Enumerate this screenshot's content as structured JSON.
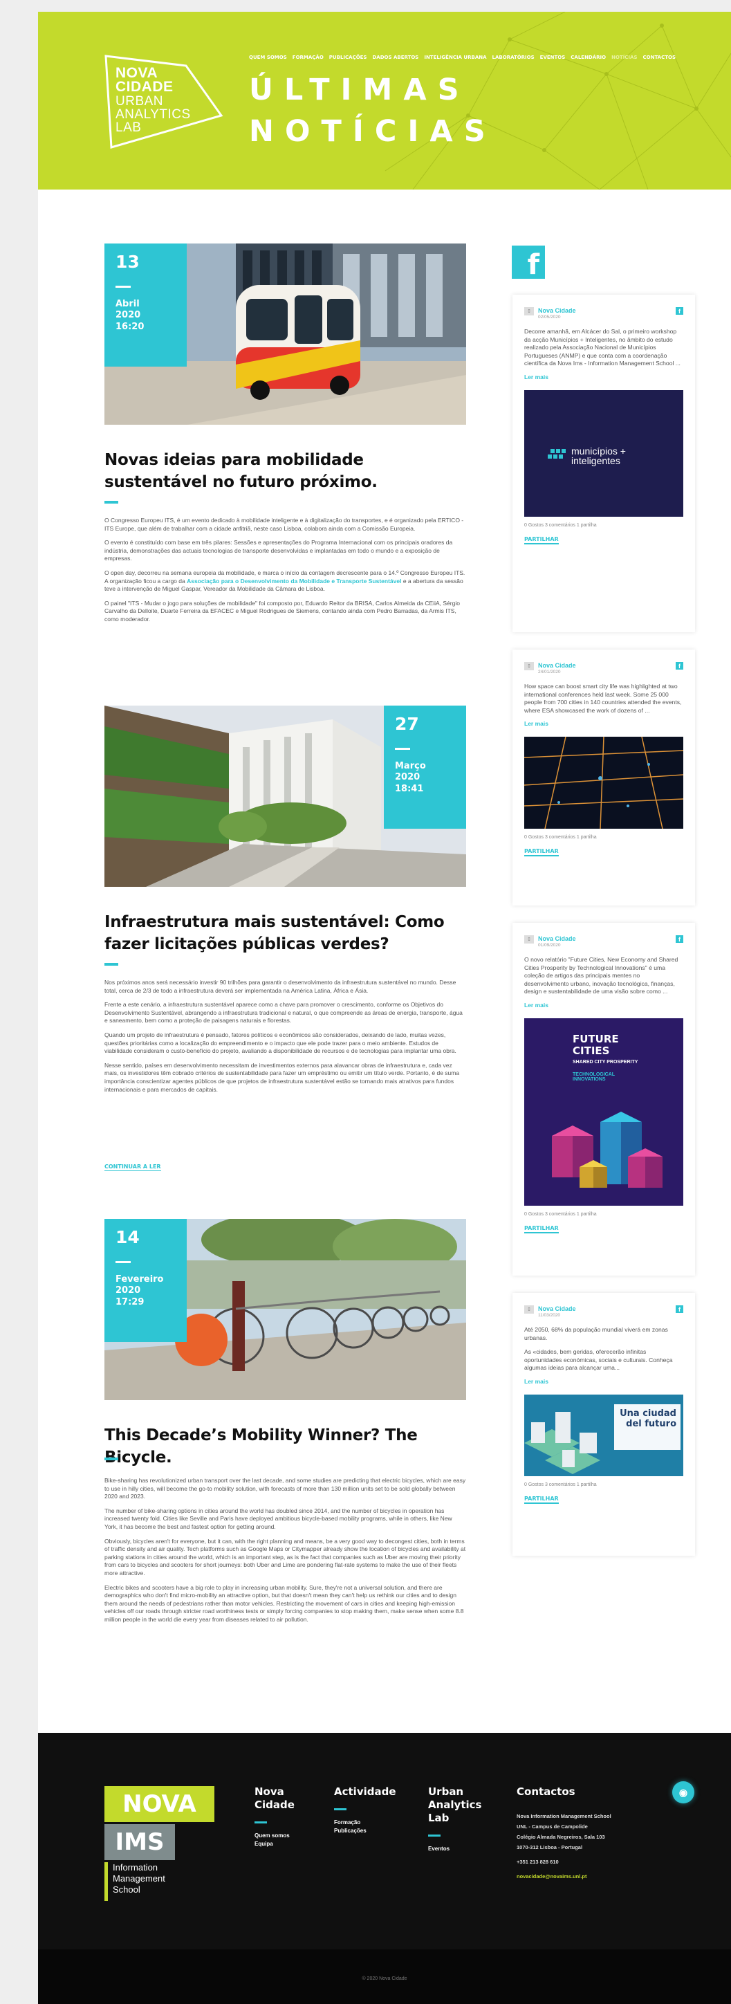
{
  "header": {
    "logo_lines": [
      "NOVA",
      "CIDADE",
      "URBAN",
      "ANALYTICS",
      "LAB"
    ],
    "nav": [
      "QUEM SOMOS",
      "FORMAÇÃO",
      "PUBLICAÇÕES",
      "DADOS ABERTOS",
      "INTELIGÊNCIA URBANA",
      "LABORATÓRIOS",
      "EVENTOS",
      "CALENDÁRIO",
      "NOTÍCIAS",
      "CONTACTOS"
    ],
    "title_line1": "ÚLTIMAS",
    "title_line2": "NOTÍCIAS",
    "colors": {
      "lime": "#c3da2c",
      "cyan": "#2ec5d3"
    }
  },
  "articles": [
    {
      "day": "13",
      "month": "Abril",
      "year": "2020",
      "time": "16:20",
      "title": "Novas ideias para mobilidade sustentável no futuro próximo.",
      "paragraphs": [
        "O Congresso Europeu ITS, é um evento dedicado à mobilidade inteligente e à digitalização do transportes, e é organizado pela ERTICO - ITS Europe, que além de trabalhar com a cidade anfitriã, neste caso Lisboa, colabora ainda com a Comissão Europeia.",
        "O evento é constituído com base em três pilares: Sessões e apresentações do Programa Internacional com os principais oradores da indústria, demonstrações das actuais tecnologias de transporte desenvolvidas e implantadas em todo o mundo e a exposição de empresas.",
        "O painel \"ITS - Mudar o jogo para soluções de mobilidade\" foi composto por, Eduardo Reitor da BRISA, Carlos Almeida da CEiiA, Sérgio Carvalho da Delloite, Duarte Ferreira da EFACEC e Miguel Rodrigues de Siemens, contando ainda com Pedro Barradas, da Armis ITS, como moderador."
      ],
      "para_link_before": "O open day, decorreu na semana europeia da mobilidade, e marca o início da contagem decrescente para o 14.º Congresso Europeu ITS. A organização ficou a cargo da ",
      "para_link": "Associação para o Desenvolvimento da Mobilidade e Transporte Sustentável",
      "para_link_after": " e a abertura da sessão teve a intervenção de Miguel Gaspar, Vereador da Mobilidade da Câmara de Lisboa."
    },
    {
      "day": "27",
      "month": "Março",
      "year": "2020",
      "time": "18:41",
      "title": "Infraestrutura mais sustentável: Como fazer licitações públicas verdes?",
      "paragraphs": [
        "Nos próximos anos será necessário investir 90 trilhões para garantir o desenvolvimento da infraestrutura sustentável no mundo. Desse total, cerca de 2/3 de todo a infraestrutura deverá ser implementada na América Latina, África e Ásia.",
        "Frente a este cenário, a infraestrutura sustentável aparece como a chave para promover o crescimento, conforme os Objetivos do Desenvolvimento Sustentável, abrangendo a infraestrutura tradicional e natural, o que compreende as áreas de energia, transporte, água e saneamento, bem como a proteção de paisagens naturais e florestas.",
        "Quando um projeto de infraestrutura é pensado, fatores políticos e econômicos são considerados, deixando de lado, muitas vezes, questões prioritárias como a localização do empreendimento e o impacto que ele pode trazer para o meio ambiente. Estudos de viabilidade consideram o custo-benefício do projeto, avaliando a disponibilidade de recursos e de tecnologias para implantar uma obra.",
        "Nesse sentido, países em desenvolvimento necessitam de investimentos externos para alavancar obras de infraestrutura e, cada vez mais, os investidores têm cobrado critérios de sustentabilidade para fazer um empréstimo ou emitir um título verde. Portanto, é de suma importância conscientizar agentes públicos de que projetos de infraestrutura sustentável estão se tornando mais atrativos para fundos internacionais e para mercados de capitais."
      ],
      "read_more": "CONTINUAR A LER"
    },
    {
      "day": "14",
      "month": "Fevereiro",
      "year": "2020",
      "time": "17:29",
      "title": "This Decade’s Mobility Winner? The Bicycle.",
      "paragraphs": [
        "Bike-sharing has revolutionized urban transport over the last decade, and some studies are predicting that electric bicycles, which are easy to use in hilly cities, will become the go-to mobility solution, with forecasts of more than 130 million units set to be sold globally between 2020 and 2023.",
        "The number of bike-sharing options in cities around the world has doubled since 2014, and the number of bicycles in operation has increased twenty fold. Cities like Seville and Paris have deployed ambitious bicycle-based mobility programs, while in others, like New York, it has become the best and fastest option for getting around.",
        "Obviously, bicycles aren't for everyone, but it can, with the right planning and means, be a very good way to decongest cities, both in terms of traffic density and air quality. Tech platforms such as Google Maps or Citymapper already show the location of bicycles and availability at parking stations in cities around the world, which is an important step, as is the fact that companies such as Uber are moving their priority from cars to bicycles and scooters for short journeys: both Uber and Lime are pondering flat-rate systems to make the use of their fleets more attractive.",
        "Electric bikes and scooters have a big role to play in increasing urban mobility. Sure, they're not a universal solution, and there are demographics who don't find micro-mobility an attractive option, but that doesn't mean they can't help us rethink our cities and to design them around the needs of pedestrians rather than motor vehicles. Restricting the movement of cars in cities and keeping high-emission vehicles off our roads through stricter road worthiness tests or simply forcing companies to stop making them, make sense when some 8.8 million people in the world die every year from diseases related to air pollution."
      ]
    }
  ],
  "sidebar": {
    "fb_glyph": "f",
    "cards": [
      {
        "name": "Nova Cidade",
        "date": "02/05/2020",
        "text": "Decorre amanhã, em Alcácer do Sal, o primeiro workshop da acção Municípios + Inteligentes, no âmbito do estudo realizado pela Associação Nacional de Municípios Portugueses (ANMP) e que conta com a coordenação científica da Nova Ims - Information Management School ...",
        "read_more": "Ler mais",
        "image_caption": "municípios + inteligentes",
        "stats": "0 Gostos 3 comentários 1 partilha",
        "share": "PARTILHAR"
      },
      {
        "name": "Nova Cidade",
        "date": "24/01/2020",
        "text": "How space can boost smart city life was highlighted at two international conferences held last week. Some 25 000 people from 700 cities in 140 countries attended the events, where ESA showcased the work of dozens of ...",
        "read_more": "Ler mais",
        "stats": "0 Gostos 3 comentários 1 partilha",
        "share": "PARTILHAR"
      },
      {
        "name": "Nova Cidade",
        "date": "01/09/2020",
        "text": "O novo relatório \"Future Cities, New Economy and Shared Cities Prosperity by Technological Innovations\" é uma coleção de artigos das principais mentes no desenvolvimento urbano, inovação tecnológica, finanças, design e sustentabilidade de uma visão sobre como ...",
        "read_more": "Ler mais",
        "image_title": "FUTURE CITIES",
        "image_sub1": "SHARED CITY PROSPERITY",
        "image_sub2": "TECHNOLOGICAL INNOVATIONS",
        "stats": "0 Gostos 3 comentários 1 partilha",
        "share": "PARTILHAR"
      },
      {
        "name": "Nova Cidade",
        "date": "11/03/2020",
        "text": "Até 2050, 68% da população mundial viverá em zonas urbanas.",
        "text2": "As «cidades, bem geridas, oferecerão infinitas oportunidades económicas, sociais e culturais. Conheça algumas ideias para alcançar uma...",
        "read_more": "Ler mais",
        "image_title": "Una ciudad del futuro",
        "stats": "0 Gostos 3 comentários 1 partilha",
        "share": "PARTILHAR"
      }
    ]
  },
  "footer": {
    "logo_nova": "NOVA",
    "logo_ims": "IMS",
    "logo_sub": [
      "Information",
      "Management",
      "School"
    ],
    "col1": {
      "heading": [
        "Nova",
        "Cidade"
      ],
      "links": [
        "Quem somos",
        "Equipa"
      ]
    },
    "col2": {
      "heading": [
        "Actividade"
      ],
      "links": [
        "Formação",
        "Publicações"
      ]
    },
    "col3": {
      "heading": [
        "Urban",
        "Analytics",
        "Lab"
      ],
      "links": [
        "Eventos"
      ]
    },
    "contacts": {
      "heading": "Contactos",
      "lines": [
        "Nova Information Management School",
        "UNL - Campus de Campolide",
        "Colégio Almada Negreiros, Sala 103",
        "1070-312 Lisboa - Portugal"
      ],
      "phone": "+351 213 828 610",
      "email": "novacidade@novaims.unl.pt"
    },
    "up_icon": "◉",
    "copyright": "© 2020 Nova Cidade"
  }
}
